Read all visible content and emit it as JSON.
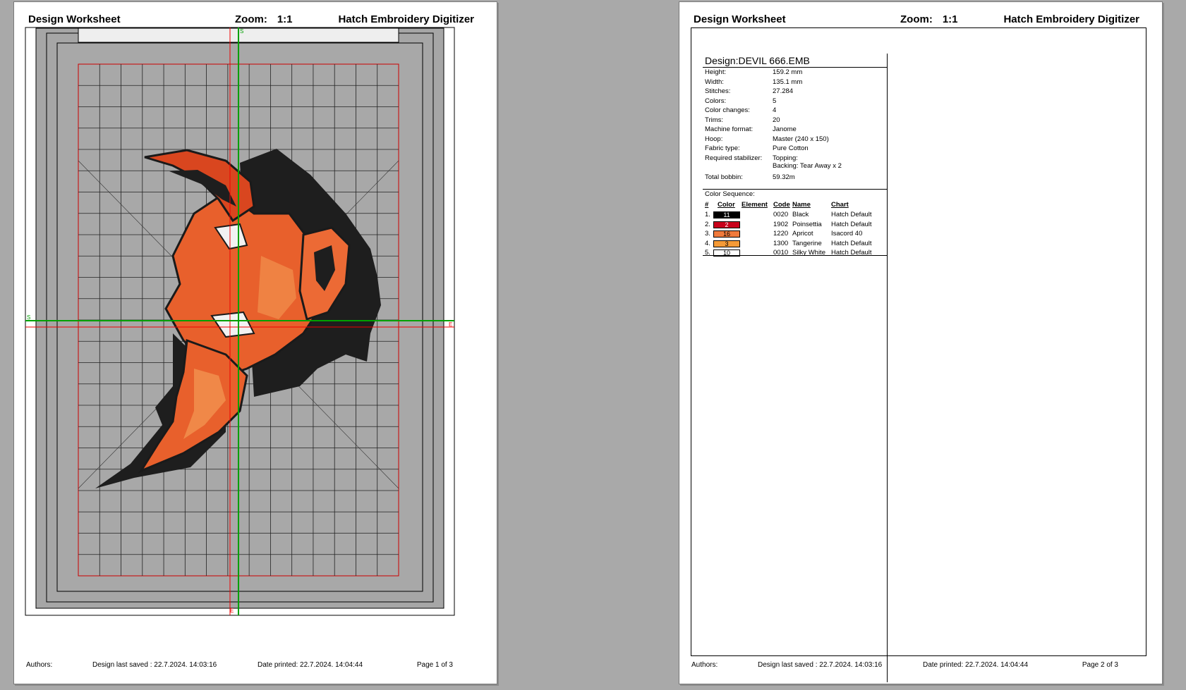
{
  "header": {
    "title": "Design Worksheet",
    "zoom_label": "Zoom:",
    "zoom_value": "1:1",
    "brand": "Hatch Embroidery Digitizer"
  },
  "page1": {
    "footer": {
      "authors": "Authors:",
      "saved": "Design last saved : 22.7.2024. 14:03:16",
      "printed": "Date printed: 22.7.2024. 14:04:44",
      "page": "Page 1 of 3"
    },
    "markers": {
      "top": "S",
      "bottom": "E",
      "left": "S",
      "right": "E"
    }
  },
  "page2": {
    "design": "Design:DEVIL 666.EMB",
    "info": [
      {
        "label": "Height:",
        "value": "159.2 mm"
      },
      {
        "label": "Width:",
        "value": "135.1 mm"
      },
      {
        "label": "Stitches:",
        "value": "27.284"
      },
      {
        "label": "Colors:",
        "value": "5"
      },
      {
        "label": "Color changes:",
        "value": "4"
      },
      {
        "label": "Trims:",
        "value": "20"
      },
      {
        "label": "Machine format:",
        "value": "Janome"
      },
      {
        "label": "Hoop:",
        "value": "Master (240 x 150)"
      },
      {
        "label": "Fabric type:",
        "value": "Pure Cotton"
      },
      {
        "label": "Required stabilizer:",
        "value": "Topping:"
      },
      {
        "label": "",
        "value": "Backing: Tear Away x 2"
      },
      {
        "label": "Total bobbin:",
        "value": "59.32m"
      }
    ],
    "color_sequence_title": "Color Sequence:",
    "columns": [
      "#",
      "Color",
      "Element",
      "Code",
      "Name",
      "Chart"
    ],
    "colors": [
      {
        "num": "1.",
        "swatch": "11",
        "code": "0020",
        "name": "Black",
        "chart": "Hatch Default",
        "hex": "#000000",
        "text_color": "#ffffff"
      },
      {
        "num": "2.",
        "swatch": "2",
        "code": "1902",
        "name": "Poinsettia",
        "chart": "Hatch Default",
        "hex": "#c8001a",
        "text_color": "#ffffff"
      },
      {
        "num": "3.",
        "swatch": "16",
        "code": "1220",
        "name": "Apricot",
        "chart": "Isacord 40",
        "hex": "#f07a3c",
        "text_color": "#000000"
      },
      {
        "num": "4.",
        "swatch": "3",
        "code": "1300",
        "name": "Tangerine",
        "chart": "Hatch Default",
        "hex": "#f59a36",
        "text_color": "#000000"
      },
      {
        "num": "5.",
        "swatch": "10",
        "code": "0010",
        "name": "Silky White",
        "chart": "Hatch Default",
        "hex": "#ffffff",
        "text_color": "#000000"
      }
    ],
    "footer": {
      "authors": "Authors:",
      "saved": "Design last saved : 22.7.2024. 14:03:16",
      "printed": "Date printed: 22.7.2024. 14:04:44",
      "page": "Page 2 of 3"
    }
  }
}
